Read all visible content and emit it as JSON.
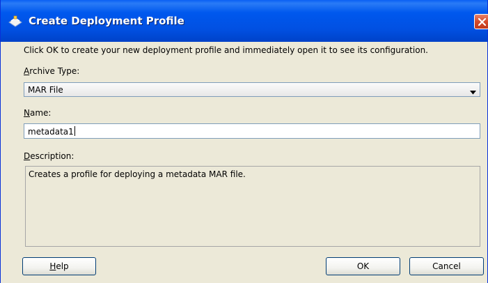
{
  "window": {
    "title": "Create Deployment Profile"
  },
  "intro_text": "Click OK to create your new deployment profile and immediately open it to see its configuration.",
  "archive_type": {
    "label_mnemonic": "A",
    "label_rest": "rchive Type:",
    "value": "MAR File"
  },
  "name": {
    "label_mnemonic": "N",
    "label_rest": "ame:",
    "value": "metadata1"
  },
  "description": {
    "label_mnemonic": "D",
    "label_rest": "escription:",
    "text": "Creates a profile for deploying a metadata MAR file."
  },
  "buttons": {
    "help_mnemonic": "H",
    "help_rest": "elp",
    "ok": "OK",
    "cancel": "Cancel"
  },
  "colors": {
    "titlebar": "#0058ee",
    "close_button": "#d44a2a",
    "dialog_background": "#ece9d8"
  },
  "icons": {
    "app": "deployment-profile-icon",
    "close": "close-icon",
    "dropdown": "chevron-down-icon"
  }
}
